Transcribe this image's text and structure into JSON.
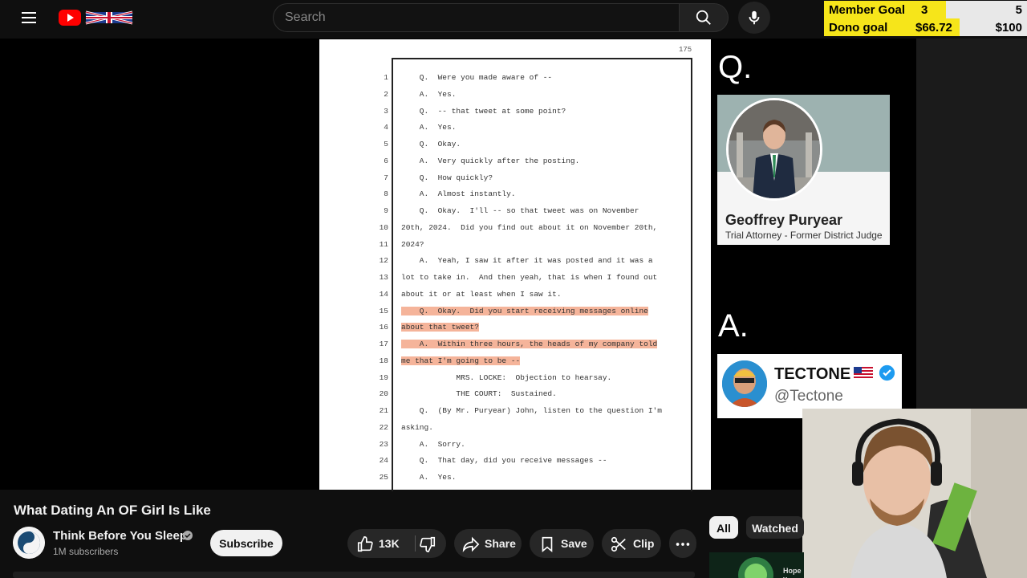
{
  "header": {
    "search_placeholder": "Search"
  },
  "goals": [
    {
      "label": "Member Goal",
      "current": "3",
      "target": "5",
      "fraction": 0.6
    },
    {
      "label": "Dono goal",
      "current": "$66.72",
      "target": "$100",
      "fraction": 0.6672
    }
  ],
  "document": {
    "page_number": "175",
    "lines": [
      {
        "n": "1",
        "text": "    Q.  Were you made aware of --",
        "hl": false
      },
      {
        "n": "2",
        "text": "    A.  Yes.",
        "hl": false
      },
      {
        "n": "3",
        "text": "    Q.  -- that tweet at some point?",
        "hl": false
      },
      {
        "n": "4",
        "text": "    A.  Yes.",
        "hl": false
      },
      {
        "n": "5",
        "text": "    Q.  Okay.",
        "hl": false
      },
      {
        "n": "6",
        "text": "    A.  Very quickly after the posting.",
        "hl": false
      },
      {
        "n": "7",
        "text": "    Q.  How quickly?",
        "hl": false
      },
      {
        "n": "8",
        "text": "    A.  Almost instantly.",
        "hl": false
      },
      {
        "n": "9",
        "text": "    Q.  Okay.  I'll -- so that tweet was on November",
        "hl": false
      },
      {
        "n": "10",
        "text": "20th, 2024.  Did you find out about it on November 20th,",
        "hl": false
      },
      {
        "n": "11",
        "text": "2024?",
        "hl": false
      },
      {
        "n": "12",
        "text": "    A.  Yeah, I saw it after it was posted and it was a",
        "hl": false
      },
      {
        "n": "13",
        "text": "lot to take in.  And then yeah, that is when I found out",
        "hl": false
      },
      {
        "n": "14",
        "text": "about it or at least when I saw it.",
        "hl": false
      },
      {
        "n": "15",
        "text": "    Q.  Okay.  Did you start receiving messages online",
        "hl": true
      },
      {
        "n": "16",
        "text": "about that tweet?",
        "hl": true
      },
      {
        "n": "17",
        "text": "    A.  Within three hours, the heads of my company told",
        "hl": true
      },
      {
        "n": "18",
        "text": "me that I'm going to be --",
        "hl": true
      },
      {
        "n": "19",
        "text": "            MRS. LOCKE:  Objection to hearsay.",
        "hl": false
      },
      {
        "n": "20",
        "text": "            THE COURT:  Sustained.",
        "hl": false
      },
      {
        "n": "21",
        "text": "    Q.  (By Mr. Puryear) John, listen to the question I'm",
        "hl": false
      },
      {
        "n": "22",
        "text": "asking.",
        "hl": false
      },
      {
        "n": "23",
        "text": "    A.  Sorry.",
        "hl": false
      },
      {
        "n": "24",
        "text": "    Q.  That day, did you receive messages --",
        "hl": false
      },
      {
        "n": "25",
        "text": "    A.  Yes.",
        "hl": false
      }
    ]
  },
  "overlay": {
    "q_label": "Q.",
    "a_label": "A.",
    "q_card": {
      "name": "Geoffrey Puryear",
      "role": "Trial Attorney - Former District Judge"
    },
    "a_card": {
      "name": "TECTONE",
      "handle": "@Tectone"
    }
  },
  "video": {
    "title": "What Dating An OF Girl Is Like",
    "channel": "Think Before You Sleep",
    "subscribers": "1M subscribers",
    "subscribe_label": "Subscribe",
    "likes": "13K",
    "share_label": "Share",
    "save_label": "Save",
    "clip_label": "Clip"
  },
  "related": {
    "chips": [
      "All",
      "Watched"
    ],
    "thumb_text": "Hope y"
  },
  "colors": {
    "highlight": "#f5b49a",
    "goal_fill": "#f6e51a",
    "youtube_red": "#ff0000"
  }
}
